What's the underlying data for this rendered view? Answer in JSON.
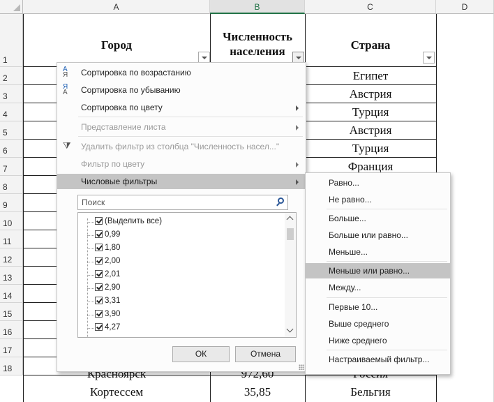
{
  "sheet": {
    "columns": [
      "A",
      "B",
      "C",
      "D"
    ],
    "rows": [
      "1",
      "2",
      "3",
      "4",
      "5",
      "6",
      "7",
      "8",
      "9",
      "10",
      "11",
      "12",
      "13",
      "14",
      "15",
      "16",
      "17",
      "18"
    ],
    "headers": {
      "a": "Город",
      "b_line1": "Численность",
      "b_line2": "населения",
      "c": "Страна"
    },
    "cells": {
      "c2": "Египет",
      "c3": "Австрия",
      "c4": "Турция",
      "c5": "Австрия",
      "c6": "Турция",
      "c7": "Франция",
      "a17": "Красноярск",
      "b17": "972,60",
      "c17": "Россия",
      "a18": "Кортессем",
      "b18": "35,85",
      "c18": "Бельгия"
    }
  },
  "filter_menu": {
    "sort_asc": "Сортировка по возрастанию",
    "sort_desc": "Сортировка по убыванию",
    "sort_color": "Сортировка по цвету",
    "sheet_view": "Представление листа",
    "clear_filter": "Удалить фильтр из столбца \"Численность насел...\"",
    "filter_color": "Фильтр по цвету",
    "number_filters": "Числовые фильтры",
    "search_placeholder": "Поиск",
    "items": [
      "(Выделить все)",
      "0,99",
      "1,80",
      "2,00",
      "2,01",
      "2,90",
      "3,31",
      "3,90",
      "4,27"
    ],
    "ok": "ОК",
    "cancel": "Отмена"
  },
  "submenu": {
    "items": [
      "Равно...",
      "Не равно...",
      "Больше...",
      "Больше или равно...",
      "Меньше...",
      "Меньше или равно...",
      "Между...",
      "Первые 10...",
      "Выше среднего",
      "Ниже среднего",
      "Настраиваемый фильтр..."
    ],
    "highlighted": "Меньше или равно..."
  }
}
